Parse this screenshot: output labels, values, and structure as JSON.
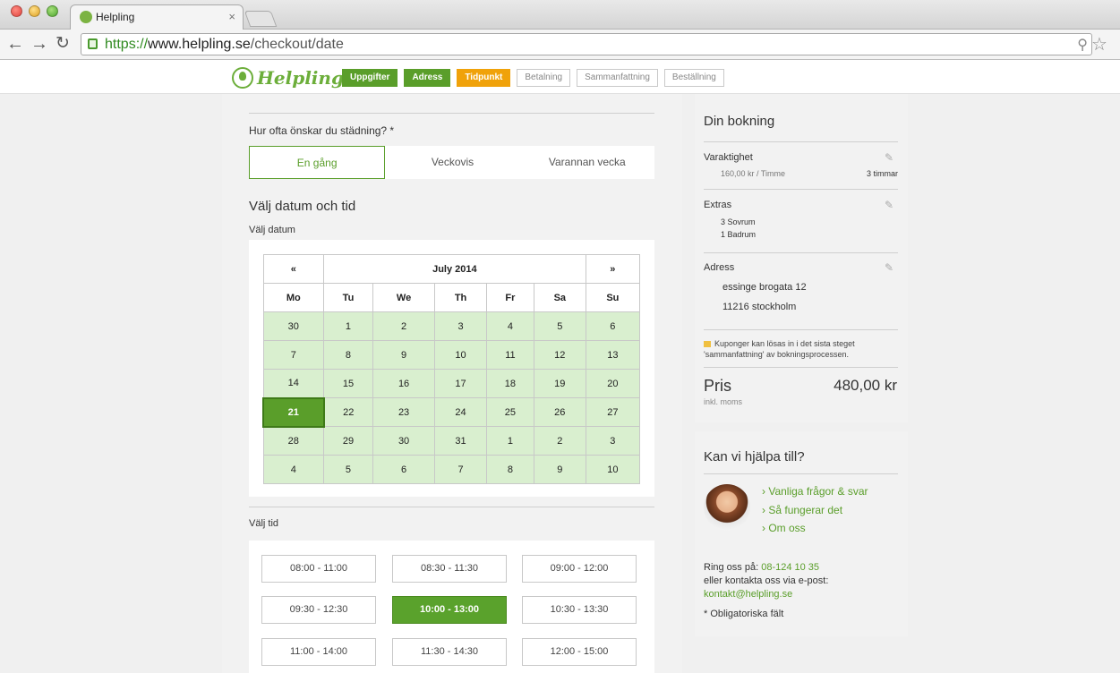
{
  "browser": {
    "tab_title": "Helpling",
    "tab_close": "×",
    "url_scheme": "https://",
    "url_host": "www.helpling.se",
    "url_path": "/checkout/date"
  },
  "header": {
    "logo_text": "Helpling",
    "steps": [
      {
        "label": "Uppgifter",
        "state": "done"
      },
      {
        "label": "Adress",
        "state": "done"
      },
      {
        "label": "Tidpunkt",
        "state": "active"
      },
      {
        "label": "Betalning",
        "state": "todo"
      },
      {
        "label": "Sammanfattning",
        "state": "todo"
      },
      {
        "label": "Beställning",
        "state": "todo"
      }
    ]
  },
  "frequency": {
    "question": "Hur ofta önskar du städning? *",
    "options": [
      "En gång",
      "Veckovis",
      "Varannan vecka"
    ],
    "selected": "En gång"
  },
  "date": {
    "heading": "Välj datum och tid",
    "label": "Välj datum",
    "prev": "«",
    "next": "»",
    "month": "July 2014",
    "weekdays": [
      "Mo",
      "Tu",
      "We",
      "Th",
      "Fr",
      "Sa",
      "Su"
    ],
    "weeks": [
      [
        "30",
        "1",
        "2",
        "3",
        "4",
        "5",
        "6"
      ],
      [
        "7",
        "8",
        "9",
        "10",
        "11",
        "12",
        "13"
      ],
      [
        "14",
        "15",
        "16",
        "17",
        "18",
        "19",
        "20"
      ],
      [
        "21",
        "22",
        "23",
        "24",
        "25",
        "26",
        "27"
      ],
      [
        "28",
        "29",
        "30",
        "31",
        "1",
        "2",
        "3"
      ],
      [
        "4",
        "5",
        "6",
        "7",
        "8",
        "9",
        "10"
      ]
    ],
    "selected_day": "21"
  },
  "time": {
    "label": "Välj tid",
    "slots": [
      "08:00 - 11:00",
      "08:30 - 11:30",
      "09:00 - 12:00",
      "09:30 - 12:30",
      "10:00 - 13:00",
      "10:30 - 13:30",
      "11:00 - 14:00",
      "11:30 - 14:30",
      "12:00 - 15:00"
    ],
    "selected": "10:00 - 13:00"
  },
  "booking": {
    "title": "Din bokning",
    "duration_label": "Varaktighet",
    "rate": "160,00 kr / Timme",
    "hours": "3 timmar",
    "extras_label": "Extras",
    "extras": [
      "3 Sovrum",
      "1 Badrum"
    ],
    "address_label": "Adress",
    "address_lines": [
      "essinge brogata 12",
      "11216 stockholm"
    ],
    "coupon_text": "Kuponger kan lösas in i det sista steget 'sammanfattning' av bokningsprocessen.",
    "price_label": "Pris",
    "price_value": "480,00 kr",
    "price_note": "inkl. moms"
  },
  "help": {
    "title": "Kan vi hjälpa till?",
    "links": [
      "Vanliga frågor & svar",
      "Så fungerar det",
      "Om oss"
    ],
    "call_prefix": "Ring oss på: ",
    "phone": "08-124 10 35",
    "email_prefix": "eller kontakta oss via e-post:",
    "email": "kontakt@helpling.se",
    "required_note": "* Obligatoriska fält"
  },
  "colors": {
    "brand_green": "#5a9e2a",
    "active_step": "#f0a20a",
    "calendar_day": "#d9efcf"
  }
}
